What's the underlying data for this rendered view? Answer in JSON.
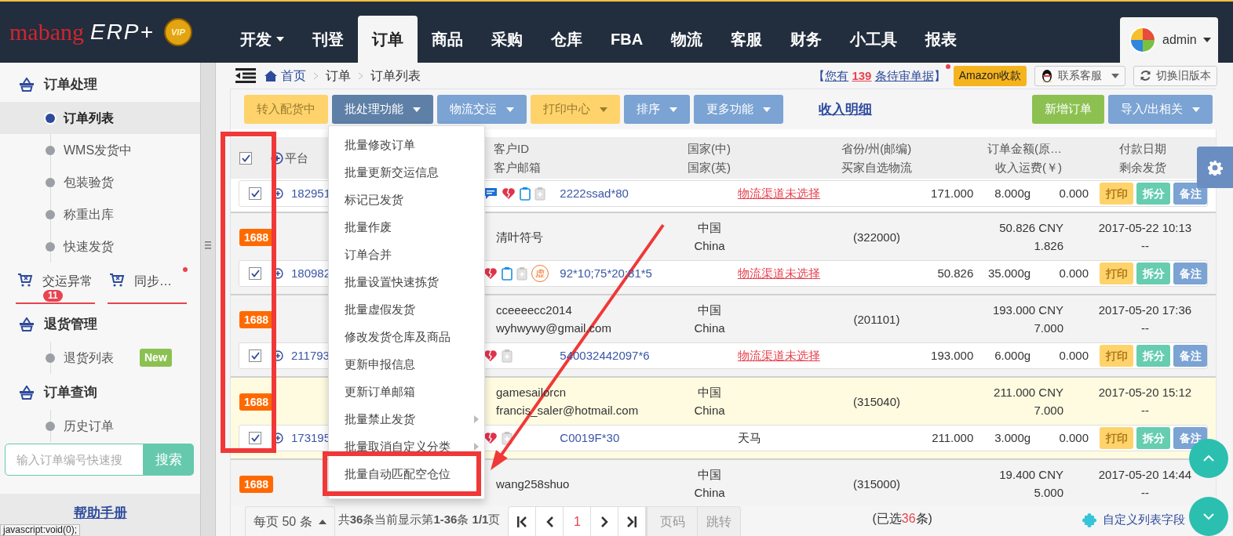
{
  "header": {
    "logo": {
      "brand": "mabang",
      "product": "ERP+",
      "badge": "VIP"
    },
    "nav": [
      {
        "label": "开发",
        "dropdown": true,
        "selected": false
      },
      {
        "label": "刊登",
        "dropdown": false,
        "selected": false
      },
      {
        "label": "订单",
        "dropdown": false,
        "selected": true
      },
      {
        "label": "商品",
        "dropdown": false,
        "selected": false
      },
      {
        "label": "采购",
        "dropdown": false,
        "selected": false
      },
      {
        "label": "仓库",
        "dropdown": false,
        "selected": false
      },
      {
        "label": "FBA",
        "dropdown": false,
        "selected": false
      },
      {
        "label": "物流",
        "dropdown": false,
        "selected": false
      },
      {
        "label": "客服",
        "dropdown": false,
        "selected": false
      },
      {
        "label": "财务",
        "dropdown": false,
        "selected": false
      },
      {
        "label": "小工具",
        "dropdown": false,
        "selected": false
      },
      {
        "label": "报表",
        "dropdown": false,
        "selected": false
      }
    ],
    "user": "admin"
  },
  "breadcrumb": [
    "首页",
    "订单",
    "订单列表"
  ],
  "notice": {
    "before": "【",
    "link": "您有",
    "count": "139",
    "link_after": "条待审单据",
    "after": "】",
    "unread": true
  },
  "top_buttons": [
    {
      "label": "Amazon收款",
      "kind": "amazon"
    },
    {
      "label": "联系客服",
      "kind": "support"
    },
    {
      "label": "切换旧版本",
      "kind": "switch"
    }
  ],
  "sidebar": {
    "groups": [
      {
        "kind": "section",
        "title": "订单处理",
        "items": [
          {
            "label": "订单列表",
            "selected": true
          },
          {
            "label": "WMS发货中",
            "selected": false
          },
          {
            "label": "包装验货",
            "selected": false
          },
          {
            "label": "称重出库",
            "selected": false
          },
          {
            "label": "快速发货",
            "selected": false
          }
        ]
      },
      {
        "kind": "tabs",
        "tabs": [
          {
            "label": "交运异常",
            "badge": "11",
            "alert": false
          },
          {
            "label": "同步…",
            "alert": true
          }
        ]
      },
      {
        "kind": "section",
        "title": "退货管理",
        "items": [
          {
            "label": "退货列表",
            "selected": false,
            "badge": "New"
          }
        ]
      },
      {
        "kind": "section",
        "title": "订单查询",
        "items": [
          {
            "label": "历史订单",
            "selected": false
          }
        ]
      }
    ],
    "search": {
      "placeholder": "输入订单编号快速搜",
      "button": "搜索"
    },
    "help": "帮助手册"
  },
  "toolbar": {
    "buttons": [
      {
        "label": "转入配货中",
        "kind": "warning",
        "dropdown": false,
        "expanded": false
      },
      {
        "label": "批处理功能",
        "kind": "info",
        "dropdown": true,
        "expanded": true
      },
      {
        "label": "物流交运",
        "kind": "info",
        "dropdown": true,
        "expanded": false
      },
      {
        "label": "打印中心",
        "kind": "warning",
        "dropdown": true,
        "expanded": false
      },
      {
        "label": "排序",
        "kind": "info",
        "dropdown": true,
        "expanded": false
      },
      {
        "label": "更多功能",
        "kind": "info",
        "dropdown": true,
        "expanded": false
      }
    ],
    "link": "收入明细",
    "right_buttons": [
      {
        "label": "新增订单",
        "kind": "success",
        "dropdown": false,
        "expanded": false
      },
      {
        "label": "导入/出相关",
        "kind": "info",
        "dropdown": true,
        "expanded": false
      }
    ]
  },
  "batch_menu": {
    "items": [
      {
        "label": "批量修改订单",
        "submenu": false,
        "highlighted": false
      },
      {
        "label": "批量更新交运信息",
        "submenu": false,
        "highlighted": false
      },
      {
        "label": "标记已发货",
        "submenu": false,
        "highlighted": false
      },
      {
        "label": "批量作废",
        "submenu": false,
        "highlighted": false
      },
      {
        "label": "订单合并",
        "submenu": false,
        "highlighted": false
      },
      {
        "label": "批量设置快速拣货",
        "submenu": false,
        "highlighted": false
      },
      {
        "label": "批量虚假发货",
        "submenu": false,
        "highlighted": false
      },
      {
        "label": "修改发货仓库及商品",
        "submenu": false,
        "highlighted": false
      },
      {
        "label": "更新申报信息",
        "submenu": false,
        "highlighted": false
      },
      {
        "label": "更新订单邮箱",
        "submenu": false,
        "highlighted": false
      },
      {
        "label": "批量禁止发货",
        "submenu": true,
        "highlighted": false
      },
      {
        "label": "批量取消自定义分类",
        "submenu": true,
        "highlighted": false
      },
      {
        "label": "批量自动匹配空仓位",
        "submenu": false,
        "highlighted": true
      }
    ]
  },
  "table": {
    "all_checked": true,
    "header": {
      "platform": "平台",
      "customer": [
        "客户ID",
        "客户邮箱"
      ],
      "country": [
        "国家(中)",
        "国家(英)"
      ],
      "region": [
        "省份/州(邮编)",
        "买家自选物流"
      ],
      "amount": [
        "订单金额(原…",
        "收入运费(￥)"
      ],
      "date": [
        "付款日期",
        "剩余发货"
      ]
    },
    "orders": [
      {
        "line": {
          "checked": true,
          "order_id": "182951",
          "icons": [
            {
              "kind": "message"
            },
            {
              "kind": "heart"
            },
            {
              "kind": "clipboard"
            },
            {
              "kind": "document"
            }
          ],
          "sku": "2222ssad*80",
          "logistics": {
            "text": "物流渠道未选择",
            "link": true
          },
          "amount": "171.000",
          "weight": "8.000g",
          "fee": "0.000",
          "actions": [
            {
              "label": "打印",
              "kind": "print"
            },
            {
              "label": "拆分",
              "kind": "split"
            },
            {
              "label": "备注",
              "kind": "note"
            }
          ]
        }
      },
      {
        "highlighted": false,
        "summary": {
          "platform": "1688",
          "customer": [
            "清叶符号"
          ],
          "country": [
            "中国",
            "China"
          ],
          "postal": "(322000)",
          "amount": [
            "50.826 CNY",
            "1.826"
          ],
          "payment": [
            "2017-05-22 10:13",
            "--"
          ]
        },
        "line": {
          "checked": true,
          "order_id": "180982",
          "icons": [
            {
              "kind": "heart"
            },
            {
              "kind": "clipboard"
            },
            {
              "kind": "document"
            },
            {
              "kind": "stamp",
              "text": "虚"
            }
          ],
          "sku": "92*10;75*20;81*5",
          "logistics": {
            "text": "物流渠道未选择",
            "link": true
          },
          "amount": "50.826",
          "weight": "35.000g",
          "fee": "0.000",
          "actions": [
            {
              "label": "打印",
              "kind": "print"
            },
            {
              "label": "拆分",
              "kind": "split"
            },
            {
              "label": "备注",
              "kind": "note"
            }
          ]
        }
      },
      {
        "highlighted": false,
        "summary": {
          "platform": "1688",
          "customer": [
            "cceeeecc2014",
            "wyhwywy@gmail.com"
          ],
          "country": [
            "中国",
            "China"
          ],
          "postal": "(201101)",
          "amount": [
            "193.000 CNY",
            "7.000"
          ],
          "payment": [
            "2017-05-20 17:36",
            "--"
          ]
        },
        "line": {
          "checked": true,
          "order_id": "211793",
          "icons": [
            {
              "kind": "heart"
            },
            {
              "kind": "document"
            }
          ],
          "sku": "540032442097*6",
          "logistics": {
            "text": "物流渠道未选择",
            "link": true
          },
          "amount": "193.000",
          "weight": "6.000g",
          "fee": "0.000",
          "actions": [
            {
              "label": "打印",
              "kind": "print"
            },
            {
              "label": "拆分",
              "kind": "split"
            },
            {
              "label": "备注",
              "kind": "note"
            }
          ]
        }
      },
      {
        "highlighted": true,
        "summary": {
          "platform": "1688",
          "customer": [
            "gamesailorcn",
            "francis_saler@hotmail.com"
          ],
          "country": [
            "中国",
            "China"
          ],
          "postal": "(315040)",
          "amount": [
            "211.000 CNY",
            "7.000"
          ],
          "payment": [
            "2017-05-20 15:12",
            "--"
          ]
        },
        "line": {
          "checked": true,
          "order_id": "173195",
          "icons": [
            {
              "kind": "heart"
            },
            {
              "kind": "document"
            }
          ],
          "sku": "C0019F*30",
          "logistics": {
            "text": "天马",
            "link": false
          },
          "amount": "211.000",
          "weight": "3.000g",
          "fee": "0.000",
          "actions": [
            {
              "label": "打印",
              "kind": "print"
            },
            {
              "label": "拆分",
              "kind": "split"
            },
            {
              "label": "备注",
              "kind": "note"
            }
          ]
        }
      },
      {
        "highlighted": false,
        "summary": {
          "platform": "1688",
          "customer": [
            "wang258shuo"
          ],
          "country": [
            "中国",
            "China"
          ],
          "postal": "(315000)",
          "amount": [
            "19.400 CNY",
            "5.000"
          ],
          "payment": [
            "2017-05-20 14:44",
            "--"
          ]
        }
      }
    ]
  },
  "pagination": {
    "page_size": "每页 50 条",
    "summary": "共**36**条当前显示第**1-36**条 **1/1**页",
    "pages": [
      {
        "label": "1",
        "selected": true
      }
    ],
    "page_placeholder": "页码",
    "jump": "跳转",
    "selected_before": "(已选",
    "selected_count": "36",
    "selected_after": "条)",
    "custom_fields": "自定义列表字段"
  },
  "status_text": "javascript:void(0);"
}
